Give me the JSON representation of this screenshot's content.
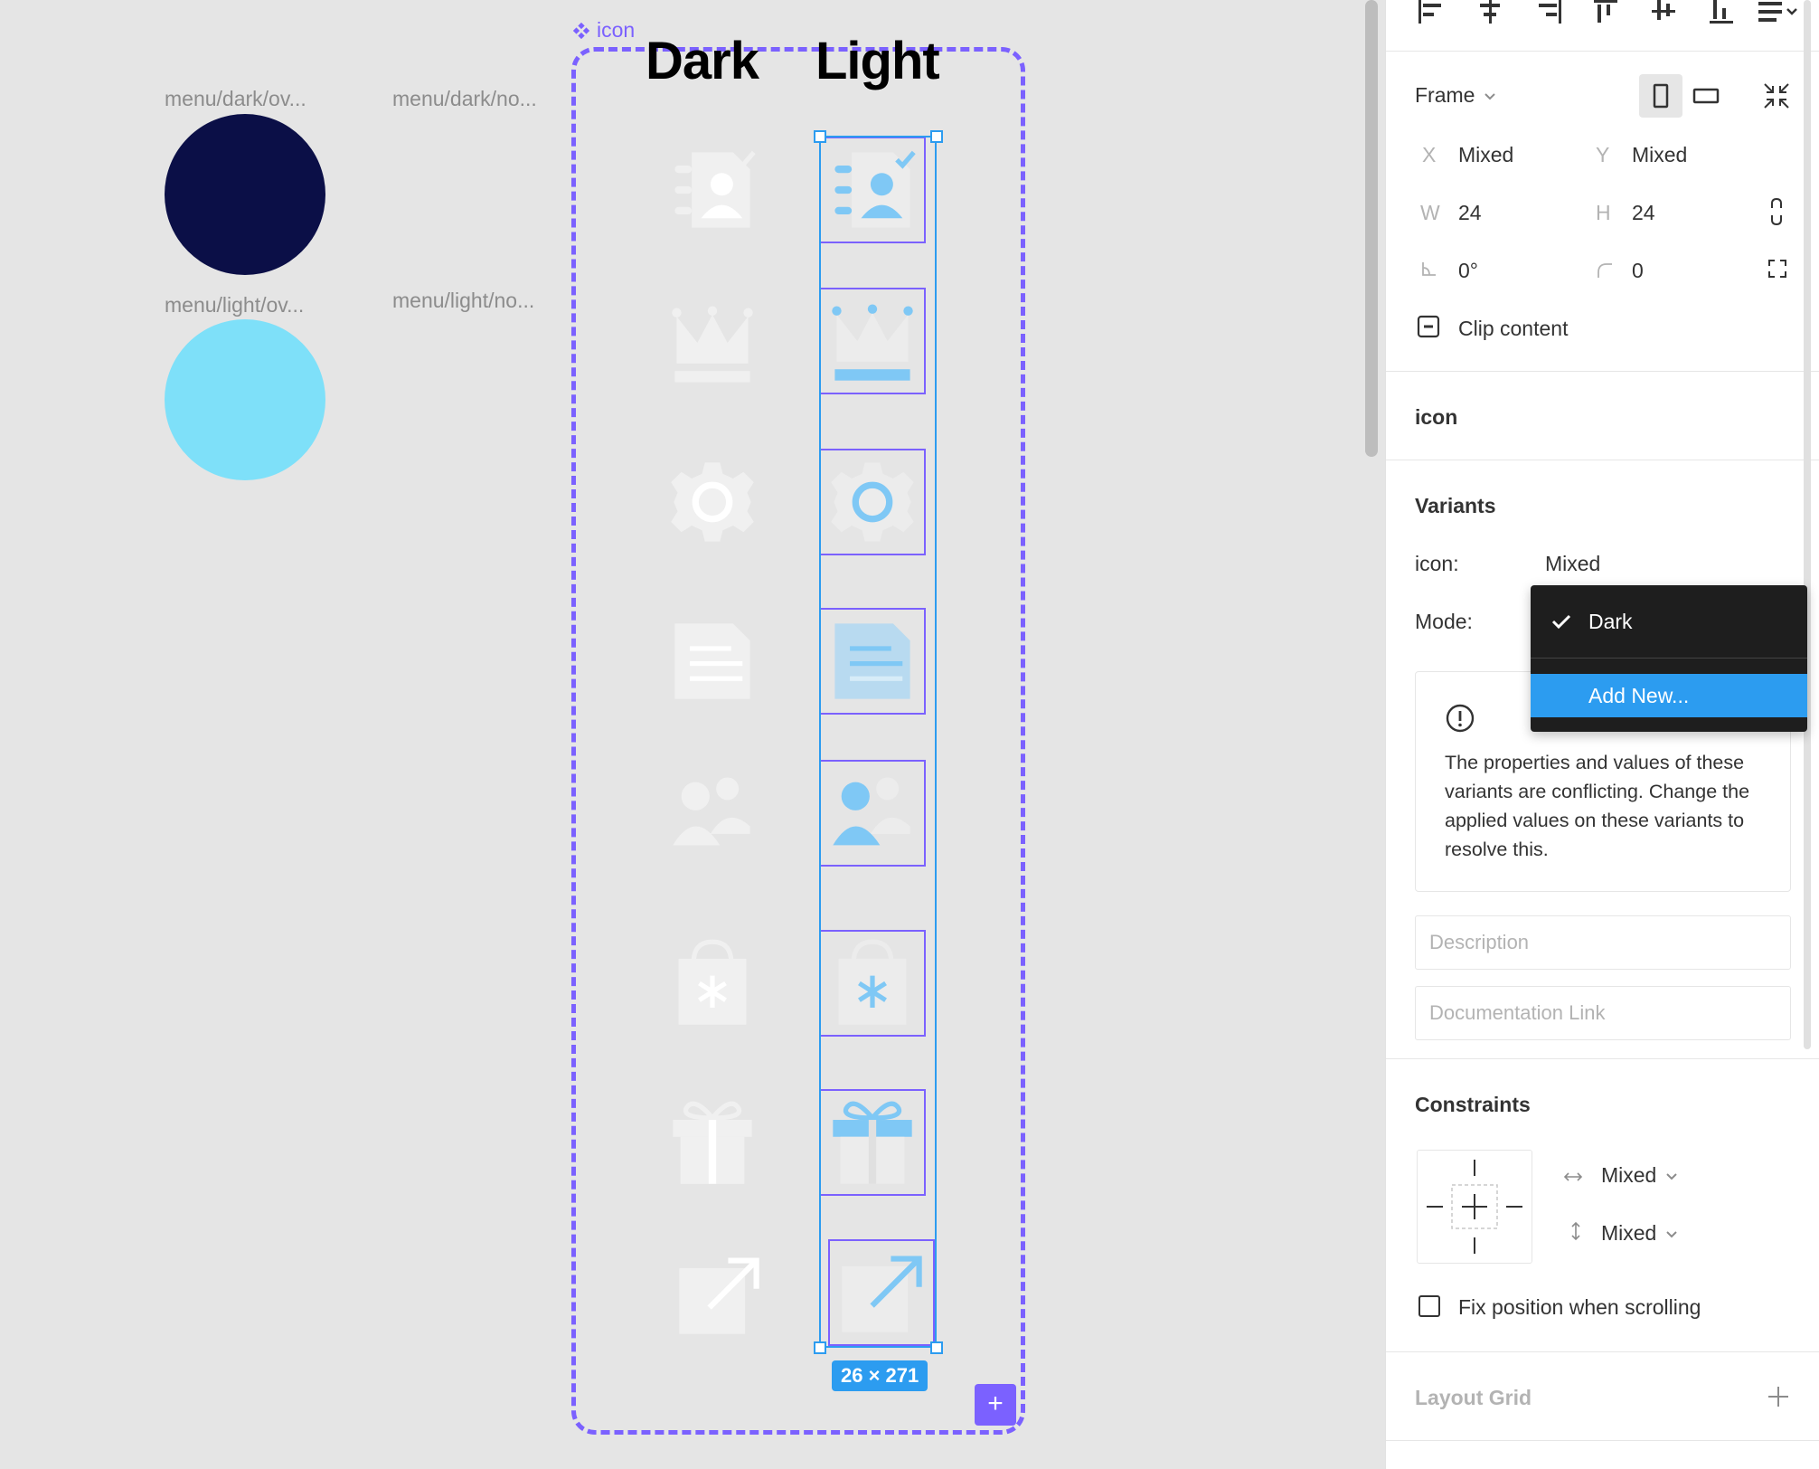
{
  "canvas": {
    "swatches": [
      {
        "label": "menu/dark/ov...",
        "color": "#0b0f47"
      },
      {
        "label": "menu/dark/no..."
      },
      {
        "label": "menu/light/ov...",
        "color": "#7ee0f9"
      },
      {
        "label": "menu/light/no..."
      }
    ],
    "component_set_name": "icon",
    "columns": {
      "dark": "Dark",
      "light": "Light"
    },
    "selection_size": "26 × 271",
    "icons": [
      "address-book-icon",
      "crown-icon",
      "settings-icon",
      "document-icon",
      "users-icon",
      "bag-icon",
      "gift-icon",
      "external-link-icon"
    ],
    "colors": {
      "dark_icon": "#f0f0f0",
      "light_icon": "#7fc8f5",
      "frame_accent": "#7b61ff",
      "selection": "#2c9cf0"
    }
  },
  "panel": {
    "frame_label": "Frame",
    "x_label": "X",
    "x_value": "Mixed",
    "y_label": "Y",
    "y_value": "Mixed",
    "w_label": "W",
    "w_value": "24",
    "h_label": "H",
    "h_value": "24",
    "rotation_value": "0°",
    "radius_value": "0",
    "clip_content_label": "Clip content",
    "component_name": "icon",
    "variants_title": "Variants",
    "variant_icon_label": "icon:",
    "variant_icon_value": "Mixed",
    "variant_mode_label": "Mode:",
    "warning_text": "The properties and values of these variants are conflicting. Change the applied values on these variants to resolve this.",
    "description_placeholder": "Description",
    "doc_link_placeholder": "Documentation Link",
    "constraints_title": "Constraints",
    "constraint_h_value": "Mixed",
    "constraint_v_value": "Mixed",
    "fix_position_label": "Fix position when scrolling",
    "layout_grid_title": "Layout Grid"
  },
  "mode_dropdown": {
    "selected": "Dark",
    "add_new": "Add New..."
  }
}
